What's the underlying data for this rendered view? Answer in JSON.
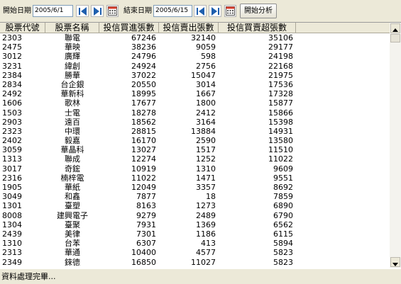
{
  "toolbar": {
    "start_label": "開始日期",
    "start_date": "2005/6/1",
    "end_label": "結束日期",
    "end_date": "2005/6/15",
    "analyze_label": "開始分析"
  },
  "table": {
    "columns": [
      "股票代號",
      "股票名稱",
      "投信買進張數",
      "投信賣出張數",
      "投信買賣超張數"
    ],
    "rows": [
      [
        "2303",
        "聯電",
        "67246",
        "32140",
        "35106"
      ],
      [
        "2475",
        "華映",
        "38236",
        "9059",
        "29177"
      ],
      [
        "3012",
        "廣輝",
        "24796",
        "598",
        "24198"
      ],
      [
        "3231",
        "緯創",
        "24924",
        "2756",
        "22168"
      ],
      [
        "2384",
        "勝華",
        "37022",
        "15047",
        "21975"
      ],
      [
        "2834",
        "台企銀",
        "20550",
        "3014",
        "17536"
      ],
      [
        "2492",
        "華新科",
        "18995",
        "1667",
        "17328"
      ],
      [
        "1606",
        "歌林",
        "17677",
        "1800",
        "15877"
      ],
      [
        "1503",
        "士電",
        "18278",
        "2412",
        "15866"
      ],
      [
        "2903",
        "遠百",
        "18562",
        "3164",
        "15398"
      ],
      [
        "2323",
        "中環",
        "28815",
        "13884",
        "14931"
      ],
      [
        "2402",
        "毅嘉",
        "16170",
        "2590",
        "13580"
      ],
      [
        "3059",
        "華晶科",
        "13027",
        "1517",
        "11510"
      ],
      [
        "1313",
        "聯成",
        "12274",
        "1252",
        "11022"
      ],
      [
        "3017",
        "奇鋐",
        "10919",
        "1310",
        "9609"
      ],
      [
        "2316",
        "楠梓電",
        "11022",
        "1471",
        "9551"
      ],
      [
        "1905",
        "華紙",
        "12049",
        "3357",
        "8692"
      ],
      [
        "3049",
        "和鑫",
        "7877",
        "18",
        "7859"
      ],
      [
        "1301",
        "臺塑",
        "8163",
        "1273",
        "6890"
      ],
      [
        "8008",
        "建興電子",
        "9279",
        "2489",
        "6790"
      ],
      [
        "1304",
        "臺聚",
        "7931",
        "1369",
        "6562"
      ],
      [
        "2439",
        "美律",
        "7301",
        "1186",
        "6115"
      ],
      [
        "1310",
        "台苯",
        "6307",
        "413",
        "5894"
      ],
      [
        "2313",
        "華通",
        "10400",
        "4577",
        "5823"
      ],
      [
        "2349",
        "錸德",
        "16850",
        "11027",
        "5823"
      ]
    ]
  },
  "status": {
    "text": "資料處理完畢..."
  },
  "icons": {
    "nav_prev": "prev-arrow-icon",
    "nav_next": "next-arrow-icon",
    "calendar": "calendar-icon",
    "scroll_up": "scroll-up-arrow-icon",
    "scroll_down": "scroll-down-arrow-icon"
  },
  "colors": {
    "nav_arrow": "#1f5fae",
    "calendar_accent": "#d9412f"
  }
}
